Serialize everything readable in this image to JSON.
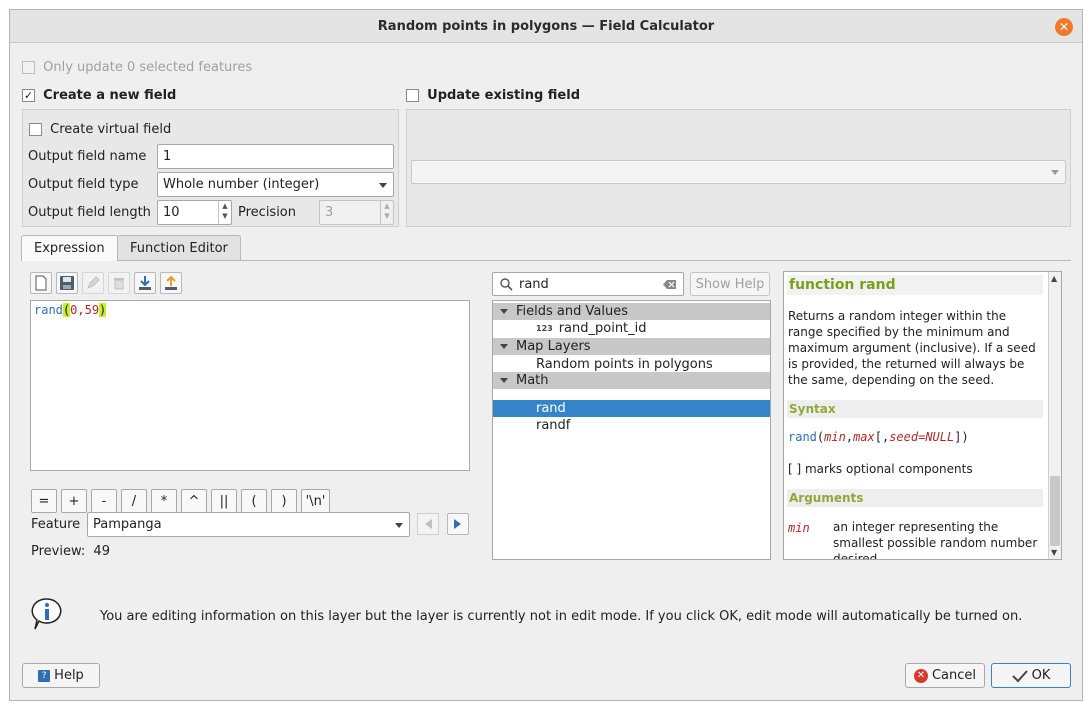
{
  "window": {
    "title": "Random points in polygons — Field Calculator",
    "close_symbol": "✕"
  },
  "top": {
    "only_selected_label": "Only update 0 selected features",
    "create_new_field_label": "Create a new field",
    "create_new_field_checked": "✓",
    "update_existing_label": "Update existing field"
  },
  "new_field": {
    "virtual_label": "Create virtual field",
    "name_label": "Output field name",
    "name_value": "1",
    "type_label": "Output field type",
    "type_value": "Whole number (integer)",
    "length_label": "Output field length",
    "length_value": "10",
    "precision_label": "Precision",
    "precision_value": "3"
  },
  "tabs": [
    {
      "label": "Expression"
    },
    {
      "label": "Function Editor"
    }
  ],
  "expression": {
    "func": "rand",
    "open_paren": "(",
    "args": "0,59",
    "close_paren": ")"
  },
  "operators": [
    "=",
    "+",
    "-",
    "/",
    "*",
    "^",
    "||",
    "(",
    ")",
    "'\\n'"
  ],
  "feature": {
    "label": "Feature",
    "value": "Pampanga"
  },
  "preview": {
    "label": "Preview:",
    "value": "49"
  },
  "search": {
    "value": "rand",
    "show_help_label": "Show Help"
  },
  "tree": {
    "groups": [
      {
        "label": "Fields and Values",
        "items": [
          {
            "badge": "123",
            "label": "rand_point_id"
          }
        ]
      },
      {
        "label": "Map Layers",
        "items": [
          {
            "label": "Random points in polygons"
          }
        ]
      },
      {
        "label": "Math",
        "items": [
          {
            "label": "rand",
            "selected": true
          },
          {
            "label": "randf"
          }
        ]
      }
    ]
  },
  "help": {
    "title": "function rand",
    "description": "Returns a random integer within the range specified by the minimum and maximum argument (inclusive). If a seed is provided, the returned will always be the same, depending on the seed.",
    "syntax_heading": "Syntax",
    "syntax_func": "rand",
    "syntax_open": "(",
    "syntax_min": "min",
    "syntax_comma": ",",
    "syntax_max": "max",
    "syntax_opt_open": "[,",
    "syntax_seed": "seed=NULL",
    "syntax_close": "])",
    "optional_note": "[ ] marks optional components",
    "arguments_heading": "Arguments",
    "arg_name": "min",
    "arg_desc": "an integer representing the smallest possible random number desired"
  },
  "info_message": "You are editing information on this layer but the layer is currently not in edit mode. If you click OK, edit mode will automatically be turned on.",
  "buttons": {
    "help": "Help",
    "cancel": "Cancel",
    "ok": "OK"
  },
  "colors": {
    "selection": "#3584c8",
    "accent_green": "#7a9f1b",
    "paren_highlight": "#c6ef2a",
    "close": "#f07a2c"
  }
}
